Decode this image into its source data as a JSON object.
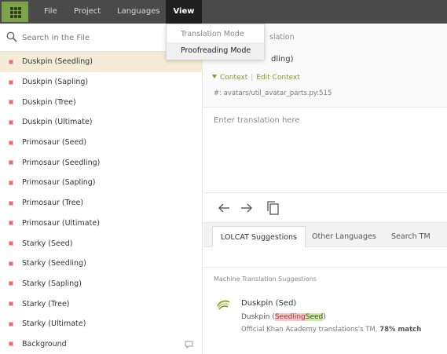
{
  "menubar": {
    "items": [
      "File",
      "Project",
      "Languages",
      "View"
    ],
    "active": "View"
  },
  "view_menu": {
    "items": [
      "Translation Mode",
      "Proofreading Mode"
    ],
    "highlighted": "Proofreading Mode"
  },
  "search": {
    "placeholder": "Search in the File"
  },
  "strings": [
    {
      "label": "Duskpin (Seedling)",
      "selected": true
    },
    {
      "label": "Duskpin (Sapling)"
    },
    {
      "label": "Duskpin (Tree)"
    },
    {
      "label": "Duskpin (Ultimate)"
    },
    {
      "label": "Primosaur (Seed)"
    },
    {
      "label": "Primosaur (Seedling)"
    },
    {
      "label": "Primosaur (Sapling)"
    },
    {
      "label": "Primosaur (Tree)"
    },
    {
      "label": "Primosaur (Ultimate)"
    },
    {
      "label": "Starky (Seed)"
    },
    {
      "label": "Starky (Seedling)"
    },
    {
      "label": "Starky (Sapling)"
    },
    {
      "label": "Starky (Tree)"
    },
    {
      "label": "Starky (Ultimate)"
    },
    {
      "label": "Background",
      "has_comment": true
    }
  ],
  "source": {
    "title_visible": "slation",
    "text_visible": "dling)",
    "context_label": "Context",
    "edit_context_label": "Edit Context",
    "path": "#: avatars/util_avatar_parts.py:515"
  },
  "translation": {
    "placeholder": "Enter translation here"
  },
  "tabs": [
    "LOLCAT Suggestions",
    "Other Languages",
    "Search TM"
  ],
  "active_tab": "LOLCAT Suggestions",
  "machine_translation": {
    "label": "Machine Translation Suggestions",
    "suggestion": "Duskpin (Sed)",
    "diff_prefix": "Duskpin (",
    "diff_removed": "Seedling",
    "diff_added": "Seed",
    "diff_suffix": ")",
    "meta_prefix": "Official Khan Academy translations's TM,",
    "meta_match": "78% match"
  },
  "colors": {
    "menubar": "#4a4a4a",
    "apps_button": "#7da34a",
    "selected_row": "#f4ecd6",
    "status_untranslated": "#e36b6b",
    "link_green": "#7a9a2a"
  }
}
